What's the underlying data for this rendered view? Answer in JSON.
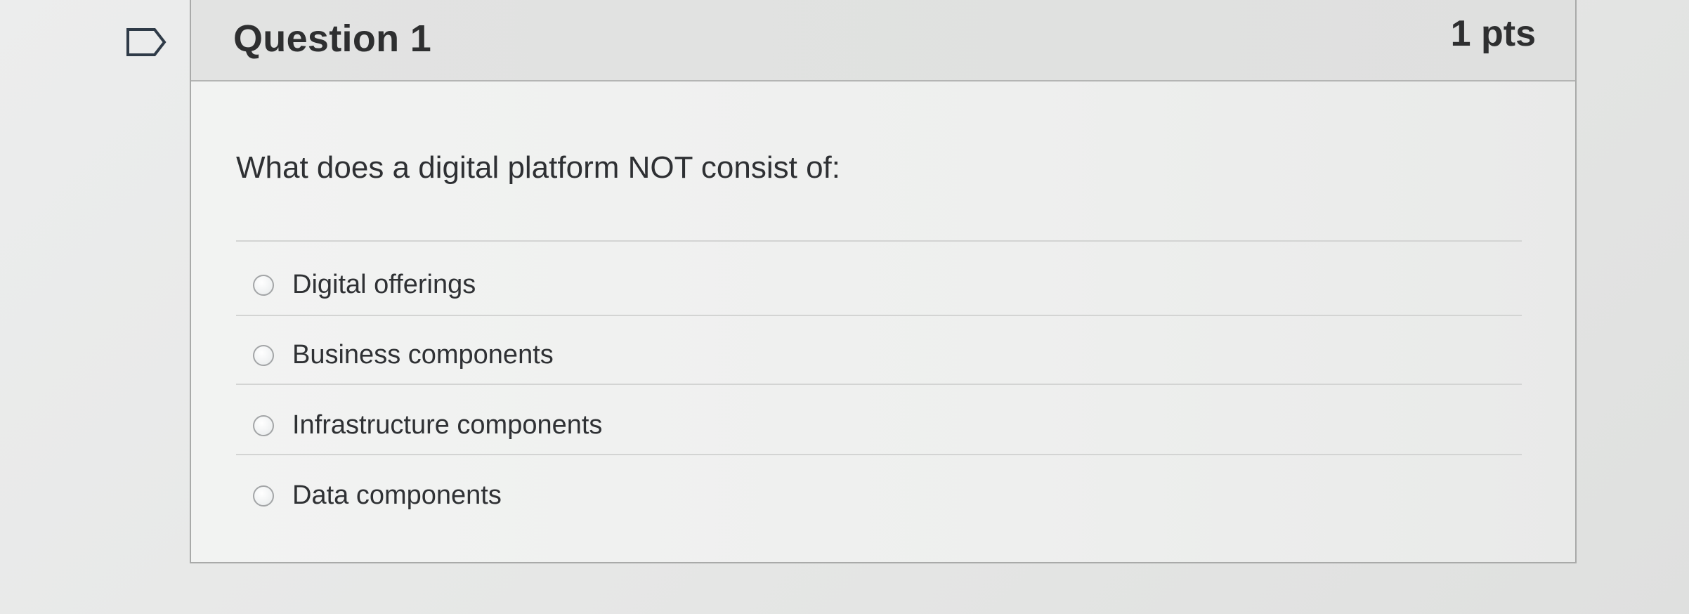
{
  "question": {
    "title": "Question 1",
    "points": "1 pts",
    "text": "What does a digital platform NOT consist of:"
  },
  "answers": [
    {
      "label": "Digital offerings",
      "selected": false
    },
    {
      "label": "Business components",
      "selected": false
    },
    {
      "label": "Infrastructure components",
      "selected": false
    },
    {
      "label": "Data components",
      "selected": false
    }
  ],
  "colors": {
    "page_background": "#e7e8e6",
    "header_background": "#dfe0df",
    "text": "#2e2f30",
    "border": "#a9aaa9"
  },
  "icons": {
    "flag": "flag-question-icon"
  }
}
